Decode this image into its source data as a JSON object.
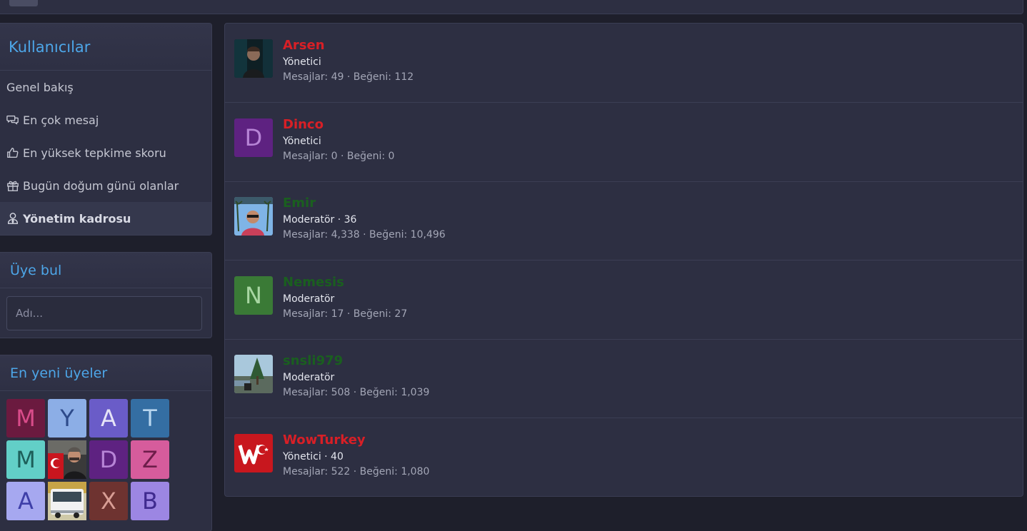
{
  "sidebar": {
    "title": "Kullanıcılar",
    "items": [
      {
        "label": "Genel bakış",
        "icon": "none"
      },
      {
        "label": "En çok mesaj",
        "icon": "comments-icon"
      },
      {
        "label": "En yüksek tepkime skoru",
        "icon": "thumbs-up-icon"
      },
      {
        "label": "Bugün doğum günü olanlar",
        "icon": "gift-icon"
      },
      {
        "label": "Yönetim kadrosu",
        "icon": "user-tie-icon",
        "selected": true
      }
    ]
  },
  "find_member": {
    "title": "Üye bul",
    "placeholder": "Adı..."
  },
  "newest_members": {
    "title": "En yeni üyeler",
    "avatars": [
      {
        "letter": "M",
        "bg": "#6b1a3f",
        "fg": "#d94c8a"
      },
      {
        "letter": "Y",
        "bg": "#8caee6",
        "fg": "#2d4a8a"
      },
      {
        "letter": "A",
        "bg": "#6a5cc8",
        "fg": "#e6e4f7"
      },
      {
        "letter": "T",
        "bg": "#346ea3",
        "fg": "#b8d6ef"
      },
      {
        "letter": "M",
        "bg": "#62cfc7",
        "fg": "#1d5f5a"
      },
      {
        "letter": "",
        "bg": "#2a2a2a",
        "fg": "#ffffff",
        "photo": "man-with-flag"
      },
      {
        "letter": "D",
        "bg": "#5e2281",
        "fg": "#b784d6"
      },
      {
        "letter": "Z",
        "bg": "#d65c9c",
        "fg": "#6e1d4a"
      },
      {
        "letter": "A",
        "bg": "#a6a8f0",
        "fg": "#3e3fa8"
      },
      {
        "letter": "",
        "bg": "#d9d6c2",
        "fg": "#000000",
        "photo": "bus"
      },
      {
        "letter": "X",
        "bg": "#6e3330",
        "fg": "#d99e95"
      },
      {
        "letter": "B",
        "bg": "#9c86e3",
        "fg": "#3f2a8f"
      }
    ]
  },
  "staff": [
    {
      "name": "Arsen",
      "name_color": "#d81f26",
      "role": "Yönetici",
      "stats": "Mesajlar: 49 · Beğeni: 112",
      "avatar": {
        "type": "photo",
        "kind": "portrait-dark"
      }
    },
    {
      "name": "Dinco",
      "name_color": "#d81f26",
      "role": "Yönetici",
      "stats": "Mesajlar: 0 · Beğeni: 0",
      "avatar": {
        "type": "letter",
        "letter": "D",
        "bg": "#5e2281",
        "fg": "#b784d6"
      }
    },
    {
      "name": "Emir",
      "name_color": "#1a5f1f",
      "role": "Moderatör · 36",
      "stats": "Mesajlar: 4,338 · Beğeni: 10,496",
      "avatar": {
        "type": "photo",
        "kind": "man-sky"
      }
    },
    {
      "name": "Nemesis",
      "name_color": "#1a5f1f",
      "role": "Moderatör",
      "stats": "Mesajlar: 17 · Beğeni: 27",
      "avatar": {
        "type": "letter",
        "letter": "N",
        "bg": "#3a7a36",
        "fg": "#a8d6a2"
      }
    },
    {
      "name": "snsli979",
      "name_color": "#1a5f1f",
      "role": "Moderatör",
      "stats": "Mesajlar: 508 · Beğeni: 1,039",
      "avatar": {
        "type": "photo",
        "kind": "tree-landscape"
      }
    },
    {
      "name": "WowTurkey",
      "name_color": "#d81f26",
      "role": "Yönetici · 40",
      "stats": "Mesajlar: 522 · Beğeni: 1,080",
      "avatar": {
        "type": "photo",
        "kind": "wow-logo"
      }
    }
  ]
}
